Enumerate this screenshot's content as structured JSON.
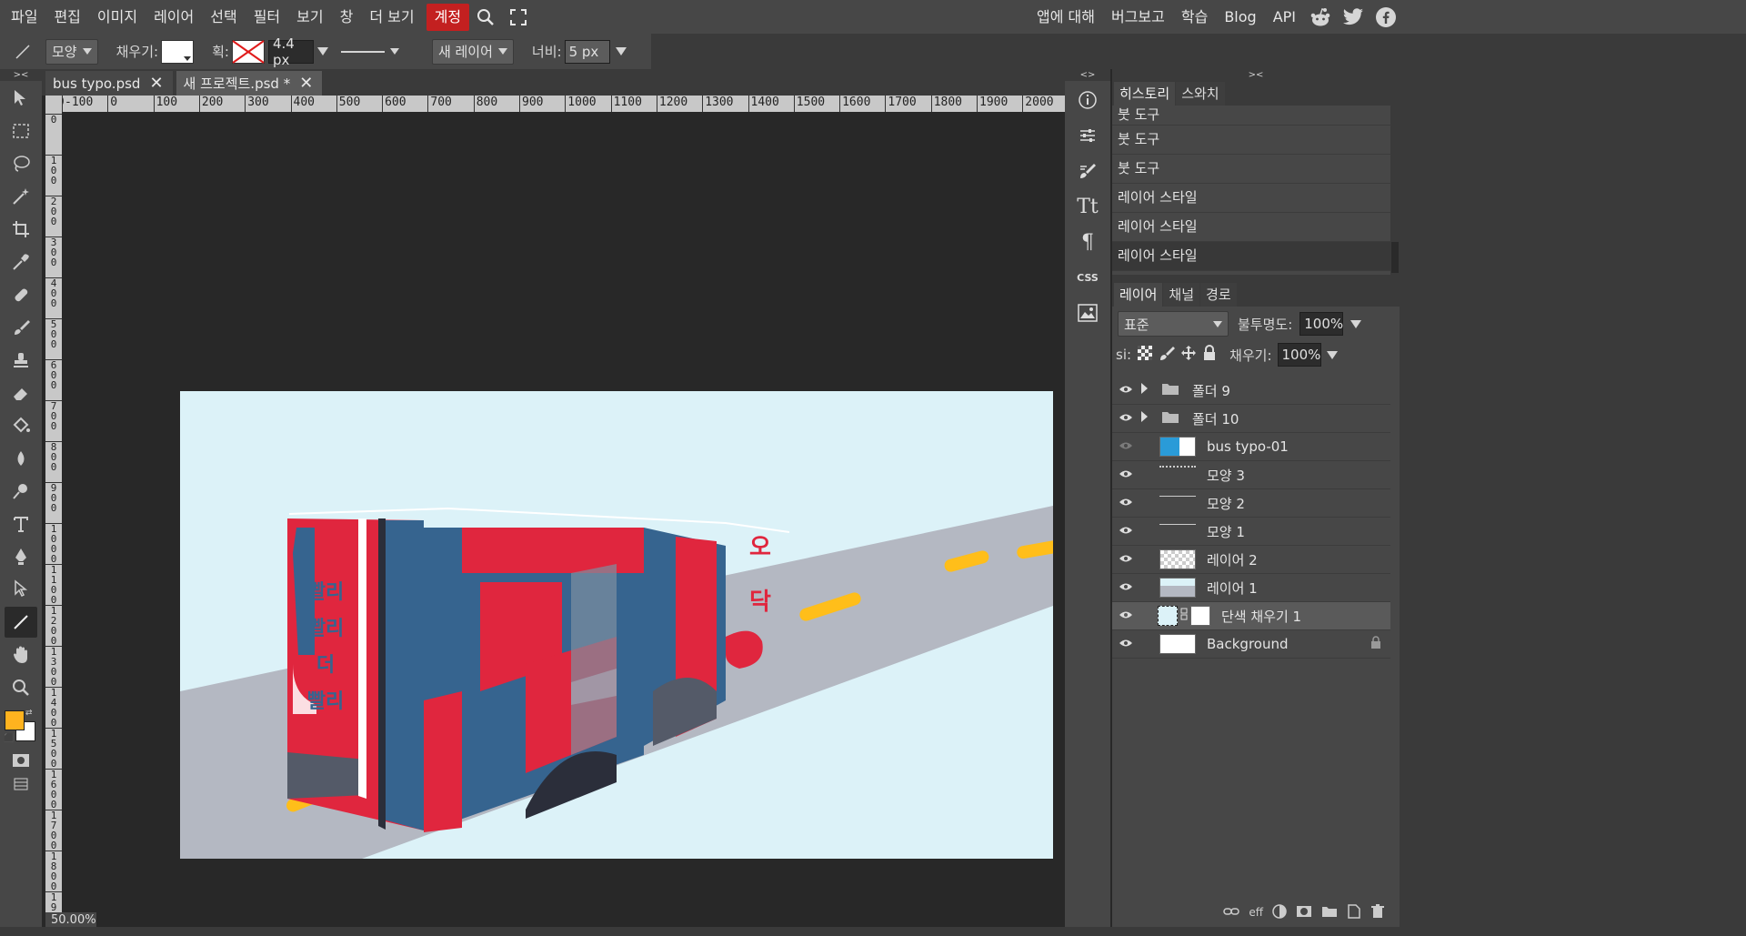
{
  "menubar": {
    "items": [
      "파일",
      "편집",
      "이미지",
      "레이어",
      "선택",
      "필터",
      "보기",
      "창",
      "더 보기"
    ],
    "account": "계정",
    "right_items": [
      "앱에 대해",
      "버그보고",
      "학습",
      "Blog",
      "API"
    ]
  },
  "options": {
    "shape_label": "모양",
    "fill_label": "채우기:",
    "stroke_label": "획:",
    "stroke_width": "4.4 px",
    "new_layer_label": "새 레이어",
    "width_label": "너비:",
    "width_value": "5 px"
  },
  "tabs": [
    {
      "label": "bus typo.psd"
    },
    {
      "label": "새 프로젝트.psd *"
    }
  ],
  "ruler": {
    "h_ticks": [
      "00",
      "-100",
      "0",
      "100",
      "200",
      "300",
      "400",
      "500",
      "600",
      "700",
      "800",
      "900",
      "1000",
      "1100",
      "1200",
      "1300",
      "1400",
      "1500",
      "1600",
      "1700",
      "1800",
      "1900",
      "2000"
    ],
    "v_ticks": [
      "0",
      "100",
      "200",
      "300",
      "400",
      "500",
      "600",
      "700",
      "800",
      "900",
      "1000",
      "1100",
      "1200",
      "1300",
      "1400",
      "1500",
      "1600",
      "1700",
      "1800",
      "1900"
    ]
  },
  "zoom": "50.00%",
  "canvas_art": {
    "bus_side_text": [
      "빨리",
      "빨리",
      "더",
      "빨리"
    ],
    "route_text": [
      "오",
      "닥"
    ],
    "colors": {
      "sky": "#dcf2f8",
      "road": "#b4b8c2",
      "red": "#e0263e",
      "blue": "#36648f",
      "yellow": "#ffbe1a",
      "dark": "#2b2e3a"
    }
  },
  "history": {
    "tabs": [
      "히스토리",
      "스와치"
    ],
    "items": [
      "붓 도구",
      "붓 도구",
      "붓 도구",
      "레이어 스타일",
      "레이어 스타일",
      "레이어 스타일"
    ]
  },
  "layers_panel": {
    "tabs": [
      "레이어",
      "채널",
      "경로"
    ],
    "blend_mode": "표준",
    "opacity_label": "불투명도:",
    "opacity": "100%",
    "lock_label": "si:",
    "fill_label": "채우기:",
    "fill": "100%",
    "layers": [
      {
        "name": "폴더 9",
        "type": "folder"
      },
      {
        "name": "폴더 10",
        "type": "folder"
      },
      {
        "name": "bus typo-01",
        "type": "smart"
      },
      {
        "name": "모양 3",
        "type": "shape"
      },
      {
        "name": "모양 2",
        "type": "shape"
      },
      {
        "name": "모양 1",
        "type": "shape"
      },
      {
        "name": "레이어 2",
        "type": "raster"
      },
      {
        "name": "레이어 1",
        "type": "raster"
      },
      {
        "name": "단색 채우기 1",
        "type": "fill",
        "selected": true
      },
      {
        "name": "Background",
        "type": "background",
        "locked": true
      }
    ],
    "footer": [
      "eff"
    ]
  },
  "colors": {
    "foreground": "#ffb31f",
    "background": "#ffffff",
    "account": "#c32020"
  }
}
